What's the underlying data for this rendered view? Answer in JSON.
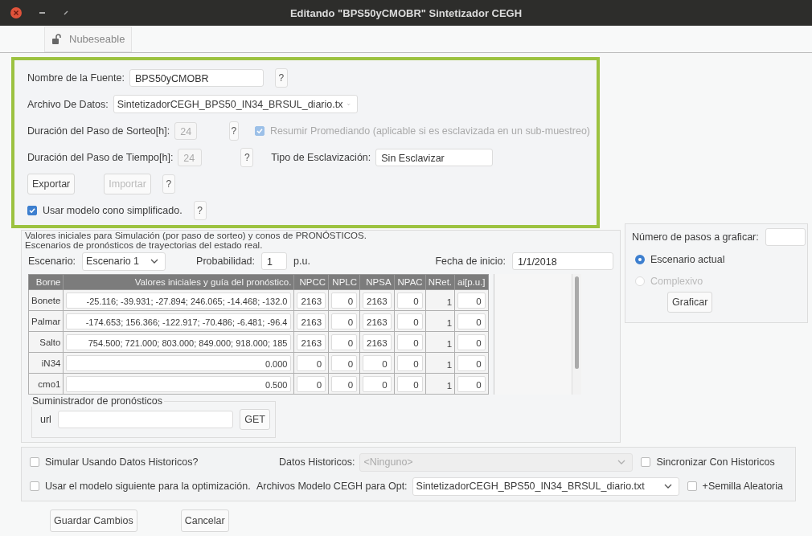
{
  "window": {
    "title": "Editando \"BPS50yCMOBR\" Sintetizador CEGH"
  },
  "toolbar": {
    "button": "Nubeseable"
  },
  "general": {
    "rows": [
      {
        "kind": "text",
        "label": "Nombre de la Fuente:",
        "value": "BPS50yCMOBR",
        "help": "?"
      },
      {
        "kind": "select",
        "label": "Archivo De Datos:",
        "value": "SintetizadorCEGH_BPS50_IN34_BRSUL_diario.tx"
      },
      {
        "kind": "number",
        "label": "Duración del Paso de Sorteo[h]:",
        "value": "24",
        "disabled": true,
        "help": "?",
        "check_label": "Resumir Promediando (aplicable si es esclavizada en un sub-muestreo)",
        "checked": true
      },
      {
        "kind": "number",
        "label": "Duración del Paso de Tiempo[h]:",
        "value": "24",
        "disabled": true,
        "help": "?",
        "extra_label": "Tipo de Esclavización:",
        "extra_value": "Sin Esclavizar"
      },
      {
        "kind": "buttons",
        "buttons": [
          {
            "label": "Exportar",
            "disabled": false
          },
          {
            "label": "Importar",
            "disabled": true
          }
        ],
        "help": "?"
      },
      {
        "kind": "checkbox",
        "label": "Usar modelo cono simplificado.",
        "checked": true,
        "help": "?"
      }
    ]
  },
  "scenarios": {
    "title_lines": [
      "Valores iniciales para Simulación (por paso de sorteo) y conos de PRONÓSTICOS.",
      "Escenarios de pronósticos de trayectorias del estado real."
    ],
    "scenario_label": "Escenario:",
    "scenario_value": "Escenario 1",
    "probability_label": "Probabilidad:",
    "probability_value": "1",
    "probability_unit": "p.u.",
    "start_label": "Fecha de inicio:",
    "start_value": "1/1/2018",
    "table": {
      "columns": [
        "Borne",
        "Valores iniciales y guía del pronóstico.",
        "NPCC",
        "NPLC",
        "NPSA",
        "NPAC",
        "NRet.",
        "ai[p.u.]"
      ],
      "rows": [
        {
          "borne": "Bonete",
          "values": "-25.116; -39.931; -27.894; 246.065; -14.468; -132.0",
          "npcc": "2163",
          "nplc": "0",
          "npsa": "2163",
          "npac": "0",
          "nret": "1",
          "ai": "0"
        },
        {
          "borne": "Palmar",
          "values": "-174.653; 156.366; -122.917; -70.486; -6.481; -96.4",
          "npcc": "2163",
          "nplc": "0",
          "npsa": "2163",
          "npac": "0",
          "nret": "1",
          "ai": "0"
        },
        {
          "borne": "Salto",
          "values": "754.500; 721.000; 803.000; 849.000; 918.000; 185",
          "npcc": "2163",
          "nplc": "0",
          "npsa": "2163",
          "npac": "0",
          "nret": "1",
          "ai": "0"
        },
        {
          "borne": "iN34",
          "values": "0.000",
          "npcc": "0",
          "nplc": "0",
          "npsa": "0",
          "npac": "0",
          "nret": "1",
          "ai": "0"
        },
        {
          "borne": "cmo1",
          "values": "0.500",
          "npcc": "0",
          "nplc": "0",
          "npsa": "0",
          "npac": "0",
          "nret": "1",
          "ai": "0"
        }
      ]
    },
    "supplier": {
      "title": "Suministrador de pronósticos",
      "url_label": "url",
      "button": "GET"
    }
  },
  "graph": {
    "steps_label": "Número de pasos a graficar:",
    "radios": [
      {
        "label": "Escenario actual",
        "selected": true,
        "disabled": false
      },
      {
        "label": "Complexivo",
        "selected": false,
        "disabled": true
      }
    ],
    "button": "Graficar"
  },
  "options": {
    "rows": [
      {
        "check_label": "Simular Usando Datos Historicos?",
        "checked": false,
        "select_label": "Datos Historicos:",
        "select_placeholder": "<Ninguno>",
        "select_disabled": true,
        "check2_label": "Sincronizar Con Historicos",
        "checked2": false
      },
      {
        "check_label": "Usar el modelo siguiente para la optimización.",
        "checked": false,
        "select_label": "Archivos Modelo CEGH para Opt:",
        "select_value": "SintetizadorCEGH_BPS50_IN34_BRSUL_diario.txt",
        "select_disabled": false,
        "check2_label": "+Semilla Aleatoria",
        "checked2": false
      }
    ]
  },
  "footer": {
    "buttons": [
      "Guardar Cambios",
      "Cancelar"
    ]
  }
}
